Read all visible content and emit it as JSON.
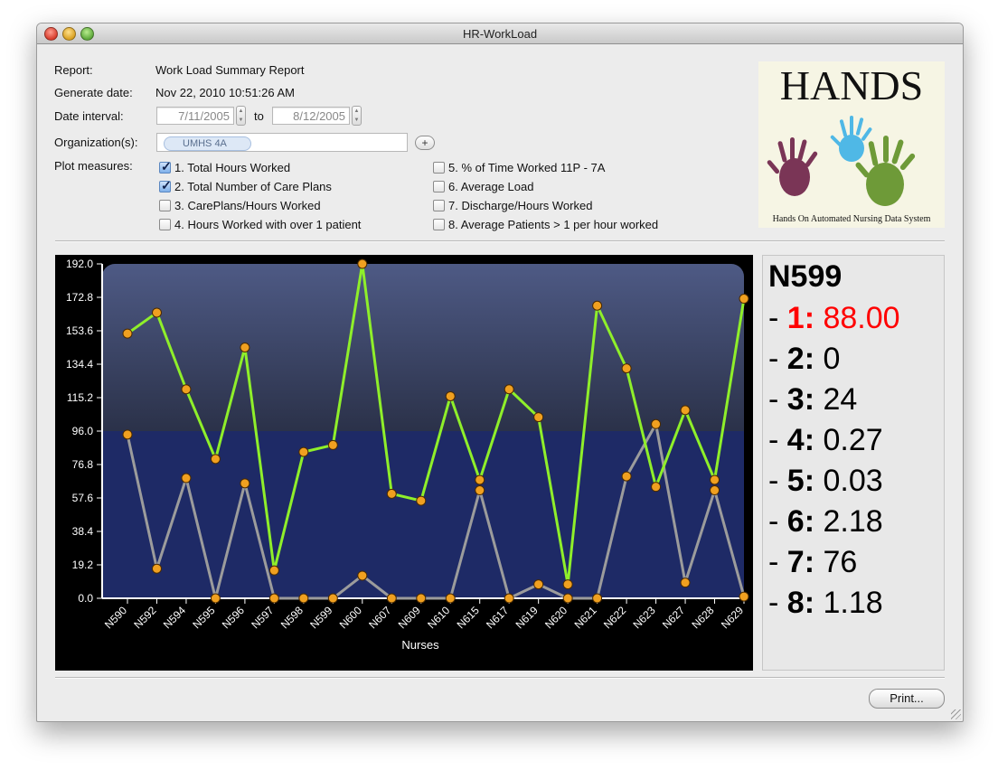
{
  "window": {
    "title": "HR-WorkLoad"
  },
  "form": {
    "report_label": "Report:",
    "report_value": "Work Load Summary Report",
    "generate_label": "Generate date:",
    "generate_value": "Nov 22, 2010 10:51:26 AM",
    "interval_label": "Date interval:",
    "date_from": "7/11/2005",
    "to_label": "to",
    "date_to": "8/12/2005",
    "org_label": "Organization(s):",
    "org_token": "UMHS 4A",
    "add_label": "+",
    "measures_label": "Plot measures:",
    "measures": [
      {
        "label": "1. Total Hours Worked",
        "checked": true
      },
      {
        "label": "2. Total Number of Care Plans",
        "checked": true
      },
      {
        "label": "3. CarePlans/Hours Worked",
        "checked": false
      },
      {
        "label": "4. Hours Worked with over 1 patient",
        "checked": false
      },
      {
        "label": "5. % of Time Worked 11P - 7A",
        "checked": false
      },
      {
        "label": "6. Average Load",
        "checked": false
      },
      {
        "label": "7. Discharge/Hours Worked",
        "checked": false
      },
      {
        "label": "8. Average Patients > 1 per hour worked",
        "checked": false
      }
    ]
  },
  "logo": {
    "title": "HANDS",
    "subtitle": "Hands On Automated Nursing Data System"
  },
  "details": {
    "nurse": "N599",
    "rows": [
      {
        "key": "1:",
        "value": "88.00",
        "highlight": true
      },
      {
        "key": "2:",
        "value": "0"
      },
      {
        "key": "3:",
        "value": "24"
      },
      {
        "key": "4:",
        "value": "0.27"
      },
      {
        "key": "5:",
        "value": "0.03"
      },
      {
        "key": "6:",
        "value": "2.18"
      },
      {
        "key": "7:",
        "value": "76"
      },
      {
        "key": "8:",
        "value": "1.18"
      }
    ]
  },
  "print_label": "Print...",
  "colors": {
    "series1": "#8fef2a",
    "series2": "#9c9c9c",
    "marker": "#f0a020",
    "highlight": "#ff0000",
    "plot_top": "#4e5a85",
    "plot_bottom": "#1e2a66"
  },
  "chart_data": {
    "type": "line",
    "xlabel": "Nurses",
    "ylabel": "",
    "ylim": [
      0,
      192
    ],
    "yticks": [
      "0.0",
      "19.2",
      "38.4",
      "57.6",
      "76.8",
      "96.0",
      "115.2",
      "134.4",
      "153.6",
      "172.8",
      "192.0"
    ],
    "categories": [
      "N590",
      "N592",
      "N594",
      "N595",
      "N596",
      "N597",
      "N598",
      "N599",
      "N600",
      "N607",
      "N609",
      "N610",
      "N615",
      "N617",
      "N619",
      "N620",
      "N621",
      "N622",
      "N623",
      "N627",
      "N628",
      "N629"
    ],
    "series": [
      {
        "values": [
          152,
          164,
          120,
          80,
          144,
          16,
          84,
          88,
          192,
          60,
          56,
          116,
          68,
          120,
          104,
          8,
          168,
          132,
          64,
          108,
          68,
          172
        ]
      },
      {
        "values": [
          94,
          17,
          69,
          0,
          66,
          0,
          0,
          0,
          13,
          0,
          0,
          0,
          62,
          0,
          8,
          0,
          0,
          70,
          100,
          9,
          62,
          1
        ]
      }
    ],
    "grid": false
  }
}
